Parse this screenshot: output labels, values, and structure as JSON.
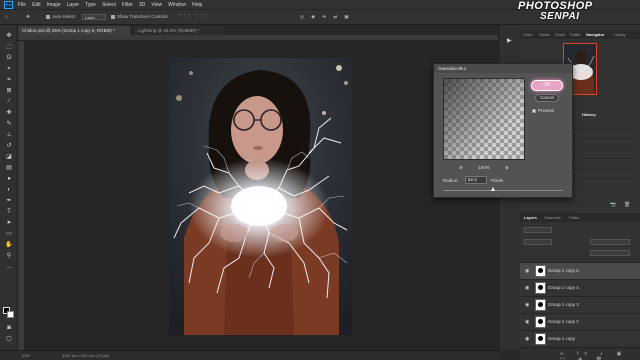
{
  "app": {
    "logo_text": "Ps"
  },
  "menu": [
    "File",
    "Edit",
    "Image",
    "Layer",
    "Type",
    "Select",
    "Filter",
    "3D",
    "View",
    "Window",
    "Help"
  ],
  "options": {
    "auto_select_label": "Auto-Select",
    "target_value": "Layer",
    "transform_label": "Show Transform Controls"
  },
  "brand": {
    "line1": "PHOTOSHOP",
    "line2": "SENPAI"
  },
  "tabs": [
    {
      "label": "Chidori.psd @ 25% (Group 1 copy 5, RGB/8) *"
    },
    {
      "label": "Lightning @ 33.3% (RGB/8#) *"
    }
  ],
  "status": {
    "zoom": "25%",
    "doc": "3167 px x 3311 px (72 ppi)"
  },
  "panels": {
    "top_tabs": [
      "Color",
      "Swatc",
      "Gradi",
      "Patter",
      "Navigator",
      "Histog"
    ],
    "active_top_tab": "Navigator",
    "history_tab": "History",
    "layer_tabs": [
      "Layers",
      "Channels",
      "Paths"
    ]
  },
  "layers": [
    {
      "name": "Group 1 copy 5",
      "selected": true
    },
    {
      "name": "Group 1 copy 4",
      "selected": false
    },
    {
      "name": "Group 1 copy 3",
      "selected": false
    },
    {
      "name": "Group 1 copy 2",
      "selected": false
    },
    {
      "name": "Group 1 copy",
      "selected": false
    }
  ],
  "dialog": {
    "title": "Gaussian Blur",
    "ok_label": "OK",
    "cancel_label": "Cancel",
    "preview_label": "Preview",
    "preview_checked": true,
    "zoom_value": "100%",
    "zoom_minus": "⊖",
    "zoom_plus": "⊕",
    "radius_label": "Radius:",
    "radius_value": "52.4",
    "radius_unit": "Pixels",
    "radius_slider_fraction": 0.42
  },
  "colors": {
    "accent_ok": "#e7a4c7",
    "nav_frame": "#e04030"
  }
}
